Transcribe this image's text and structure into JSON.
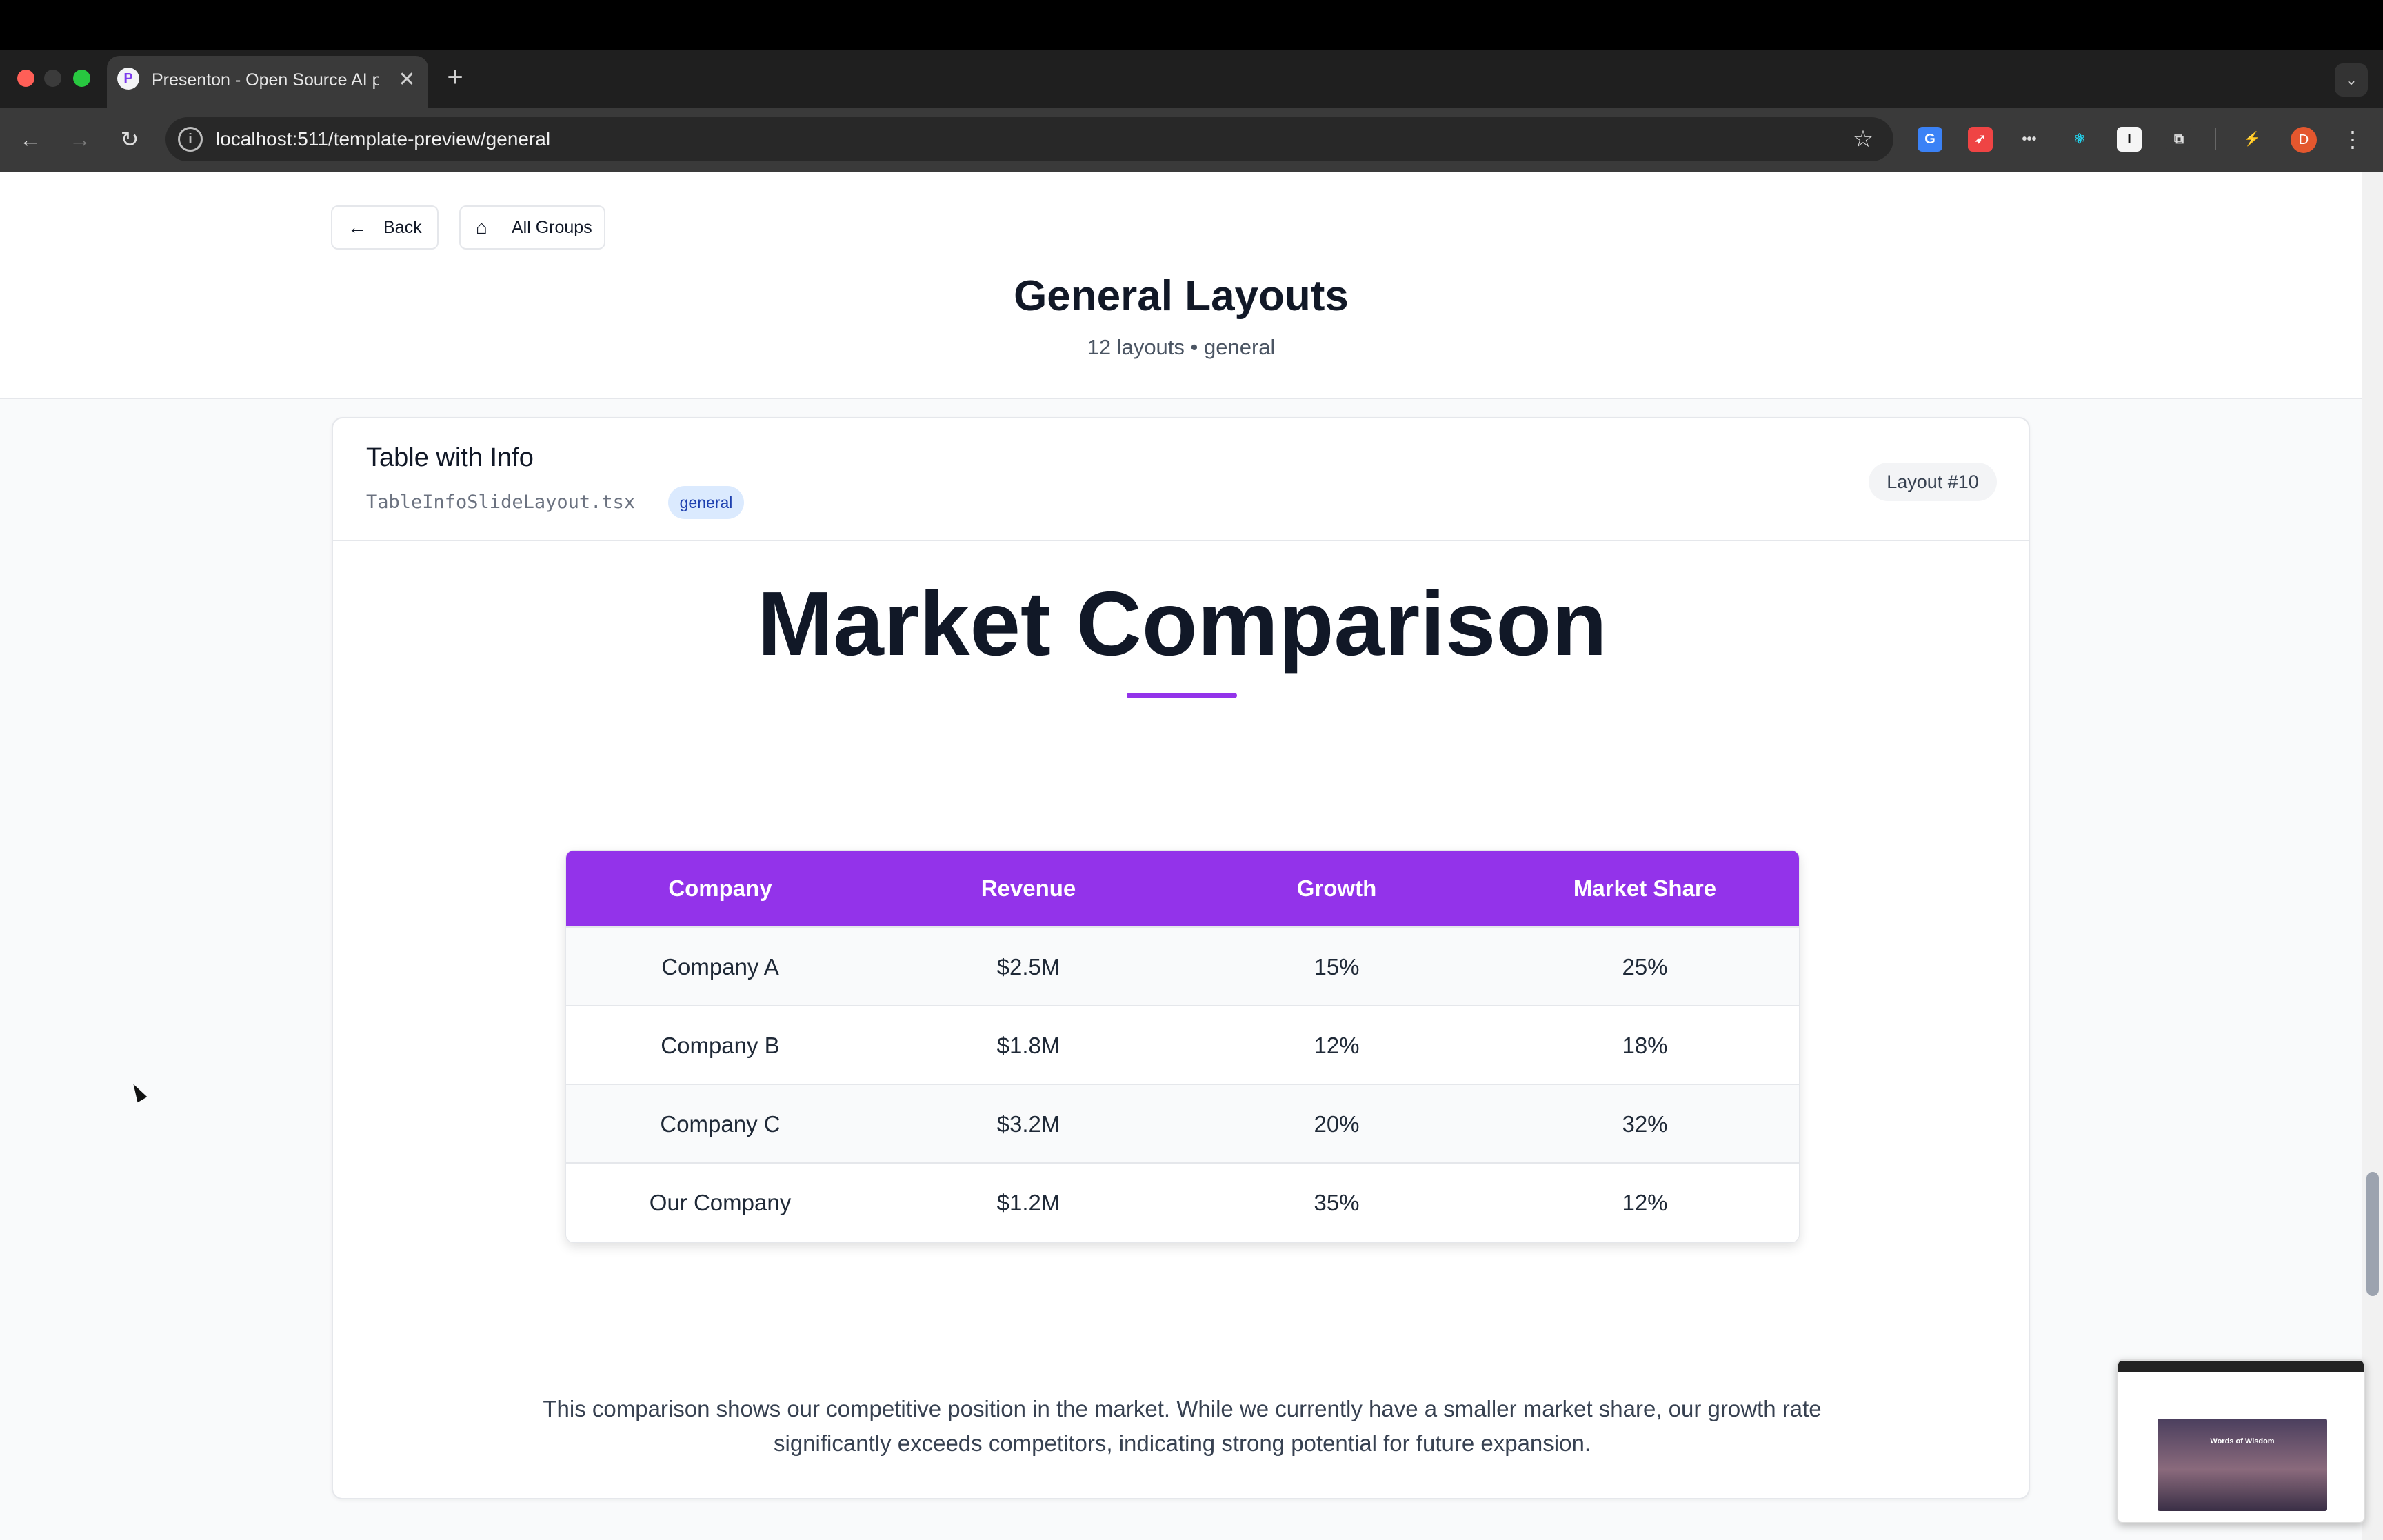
{
  "browser": {
    "tab": {
      "title": "Presenton - Open Source AI p",
      "favicon": "P",
      "close": "✕"
    },
    "new_tab": "+",
    "tab_menu": "⌄",
    "url": "localhost:511/template-preview/general",
    "profile_initial": "D",
    "icons": [
      "back-arrow-icon",
      "forward-arrow-icon",
      "reload-icon",
      "site-info-icon",
      "bookmark-star-icon",
      "translate-extension-icon",
      "rocket-extension-icon",
      "password-extension-icon",
      "react-devtools-icon",
      "instapaper-extension-icon",
      "extensions-puzzle-icon",
      "performance-icon",
      "profile-avatar",
      "kebab-menu-icon"
    ]
  },
  "header": {
    "back_label": "Back",
    "all_groups_label": "All Groups",
    "title": "General Layouts",
    "subtitle": "12 layouts • general"
  },
  "card": {
    "title": "Table with Info",
    "file": "TableInfoSlideLayout.tsx",
    "tag": "general",
    "badge": "Layout #10"
  },
  "slide": {
    "title": "Market Comparison",
    "accent_color": "#9333ea",
    "table": {
      "headers": [
        "Company",
        "Revenue",
        "Growth",
        "Market Share"
      ],
      "rows": [
        [
          "Company A",
          "$2.5M",
          "15%",
          "25%"
        ],
        [
          "Company B",
          "$1.8M",
          "12%",
          "18%"
        ],
        [
          "Company C",
          "$3.2M",
          "20%",
          "32%"
        ],
        [
          "Our Company",
          "$1.2M",
          "35%",
          "12%"
        ]
      ]
    },
    "description": "This comparison shows our competitive position in the market. While we currently have a smaller market share, our growth rate significantly exceeds competitors, indicating strong potential for future expansion."
  },
  "mini_preview": {
    "title": "Words of Wisdom"
  }
}
